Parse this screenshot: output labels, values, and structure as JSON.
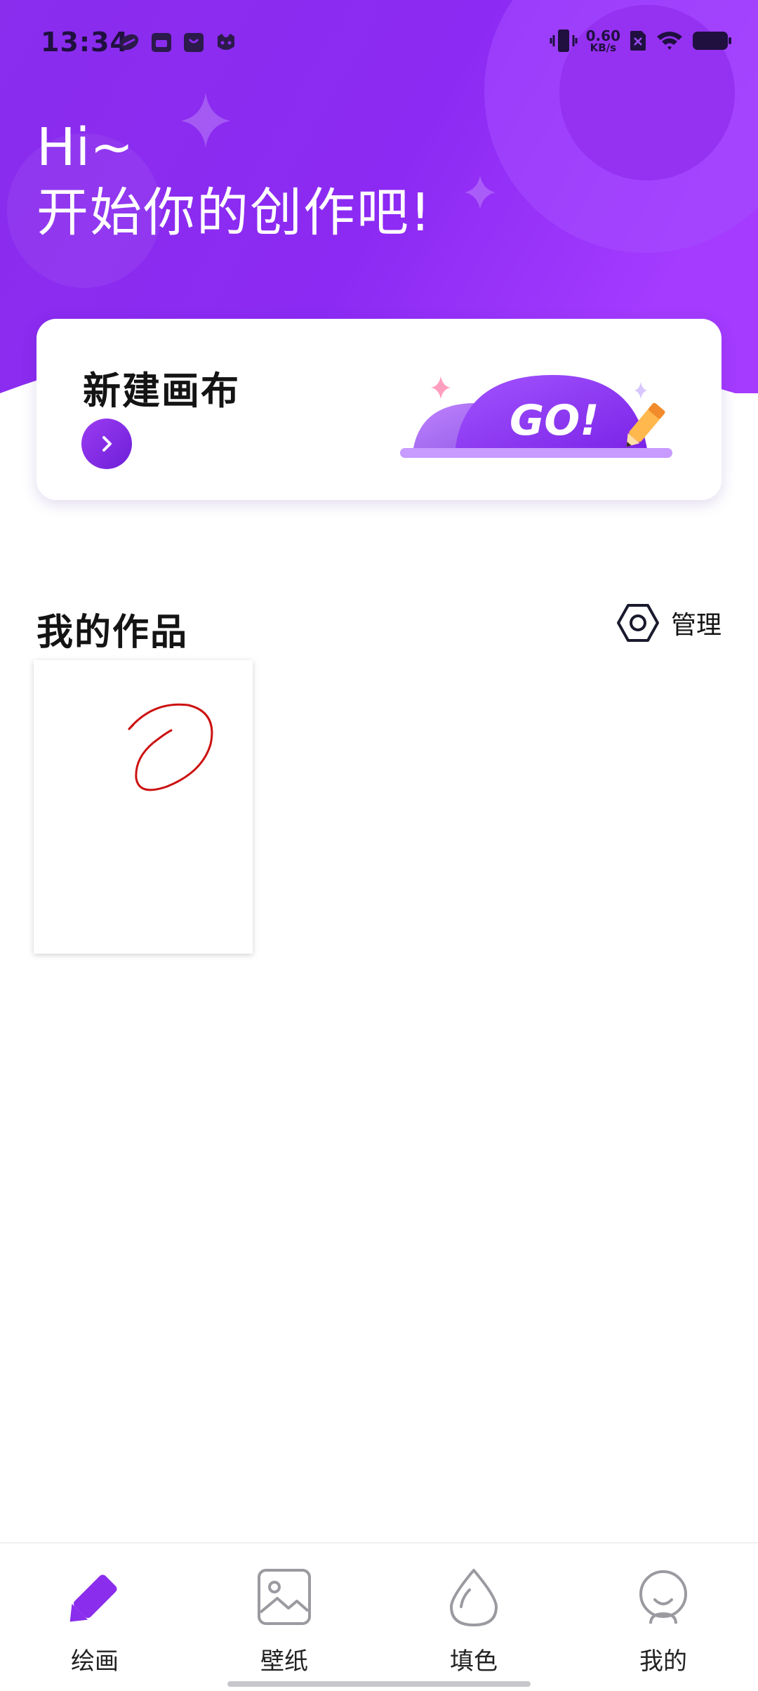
{
  "status_bar": {
    "time": "13:34",
    "net_speed_value": "0.60",
    "net_speed_unit": "KB/s"
  },
  "hero": {
    "greeting_line1": "Hi~",
    "greeting_line2": "开始你的创作吧!"
  },
  "new_canvas_card": {
    "title": "新建画布",
    "art_text": "GO!"
  },
  "works": {
    "title": "我的作品",
    "manage_label": "管理"
  },
  "bottom_nav": {
    "items": [
      {
        "label": "绘画",
        "icon": "pencil-icon",
        "active": true
      },
      {
        "label": "壁纸",
        "icon": "image-icon",
        "active": false
      },
      {
        "label": "填色",
        "icon": "drop-icon",
        "active": false
      },
      {
        "label": "我的",
        "icon": "profile-icon",
        "active": false
      }
    ]
  },
  "colors": {
    "brand_purple": "#8a2be2",
    "active_tab": "#8a2be2",
    "inactive_icon": "#9a9aa0"
  }
}
